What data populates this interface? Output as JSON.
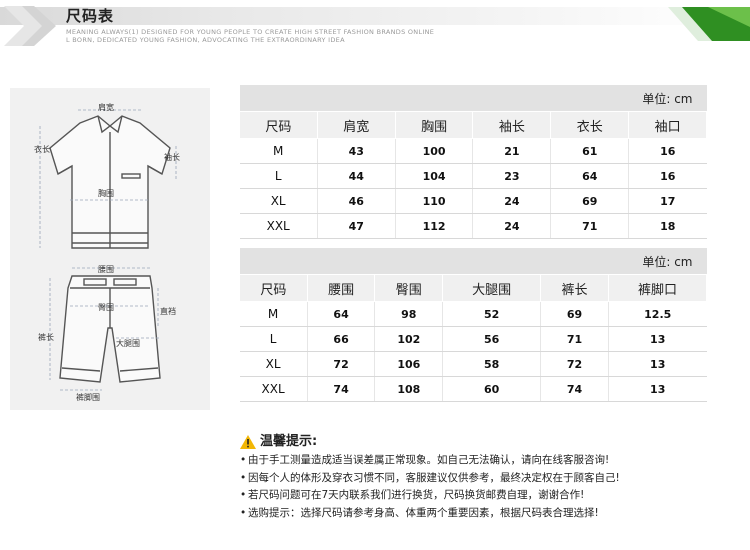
{
  "header": {
    "title": "尺码表",
    "subtitle_line1": "MEANING ALWAYS(1) DESIGNED FOR YOUNG PEOPLE TO CREATE HIGH STREET FASHION BRANDS ONLINE",
    "subtitle_line2": "L BORN, DEDICATED YOUNG FASHION, ADVOCATING THE EXTRAORDINARY IDEA"
  },
  "illustration": {
    "shirt_labels": {
      "shoulder": "肩宽",
      "length": "衣长",
      "sleeve": "袖长",
      "chest": "胸围"
    },
    "pants_labels": {
      "waist": "腰围",
      "hip": "臀围",
      "rise": "直裆",
      "thigh": "大腿围",
      "length": "裤长",
      "hem": "裤脚围"
    }
  },
  "top_table": {
    "unit": "单位: cm",
    "headers": [
      "尺码",
      "肩宽",
      "胸围",
      "袖长",
      "衣长",
      "袖口"
    ],
    "rows": [
      [
        "M",
        "43",
        "100",
        "21",
        "61",
        "16"
      ],
      [
        "L",
        "44",
        "104",
        "23",
        "64",
        "16"
      ],
      [
        "XL",
        "46",
        "110",
        "24",
        "69",
        "17"
      ],
      [
        "XXL",
        "47",
        "112",
        "24",
        "71",
        "18"
      ]
    ]
  },
  "bottom_table": {
    "unit": "单位: cm",
    "headers": [
      "尺码",
      "腰围",
      "臀围",
      "大腿围",
      "裤长",
      "裤脚口"
    ],
    "rows": [
      [
        "M",
        "64",
        "98",
        "52",
        "69",
        "12.5"
      ],
      [
        "L",
        "66",
        "102",
        "56",
        "71",
        "13"
      ],
      [
        "XL",
        "72",
        "106",
        "58",
        "72",
        "13"
      ],
      [
        "XXL",
        "74",
        "108",
        "60",
        "74",
        "13"
      ]
    ]
  },
  "tips": {
    "title": "温馨提示:",
    "lines": [
      "由于手工测量造成适当误差属正常现象。如自己无法确认，请向在线客服咨询!",
      "因每个人的体形及穿衣习惯不同，客服建议仅供参考，最终决定权在于顾客自己!",
      "若尺码问题可在7天内联系我们进行换货，尺码换货邮费自理，谢谢合作!",
      "选购提示：选择尺码请参考身高、体重两个重要因素，根据尺码表合理选择!"
    ]
  },
  "colors": {
    "accent_green": "#3a9a2a",
    "table_header_bg": "#f0f0f0",
    "unit_bar_bg": "#e2e2e2",
    "warning_yellow": "#f2b705"
  },
  "icons": [
    "chevron-logo-icon",
    "warning-icon",
    "green-corner-decoration"
  ]
}
